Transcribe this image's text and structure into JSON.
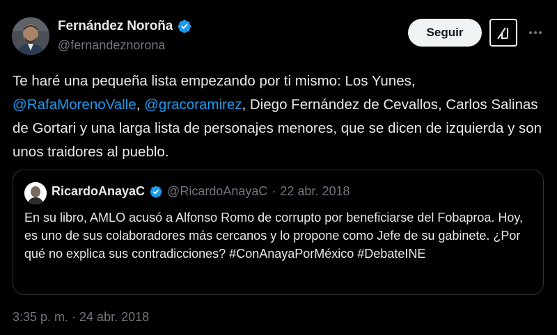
{
  "author": {
    "display_name": "Fernández Noroña",
    "handle": "@fernandeznorona",
    "verified": true
  },
  "actions": {
    "follow_label": "Seguir",
    "grok_icon": "grok-icon",
    "more_icon": "more-icon"
  },
  "tweet": {
    "part1": "Te haré una pequeña lista empezando por ti mismo: Los Yunes, ",
    "mention1": "@RafaMorenoValle",
    "part2": ", ",
    "mention2": "@gracoramirez",
    "part3": ", Diego Fernández de Cevallos, Carlos Salinas de Gortari y una larga lista de personajes menores, que se dicen de izquierda y son unos traidores al pueblo."
  },
  "quoted_tweet": {
    "display_name": "RicardoAnayaC",
    "handle": "@RicardoAnayaC",
    "separator": "·",
    "date": "22 abr. 2018",
    "text": "En su libro, AMLO acusó a Alfonso Romo de corrupto por beneficiarse del Fobaproa. Hoy, es uno de sus colaboradores más cercanos y lo propone como Jefe de su gabinete. ¿Por qué no explica sus contradicciones? #ConAnayaPorMéxico #DebateINE",
    "verified": true
  },
  "timestamp": "3:35 p. m. · 24 abr. 2018",
  "colors": {
    "background": "#000000",
    "text": "#e7e9ea",
    "secondary": "#71767b",
    "link": "#1d9bf0",
    "verified": "#1d9bf0",
    "border": "#2f3336"
  }
}
